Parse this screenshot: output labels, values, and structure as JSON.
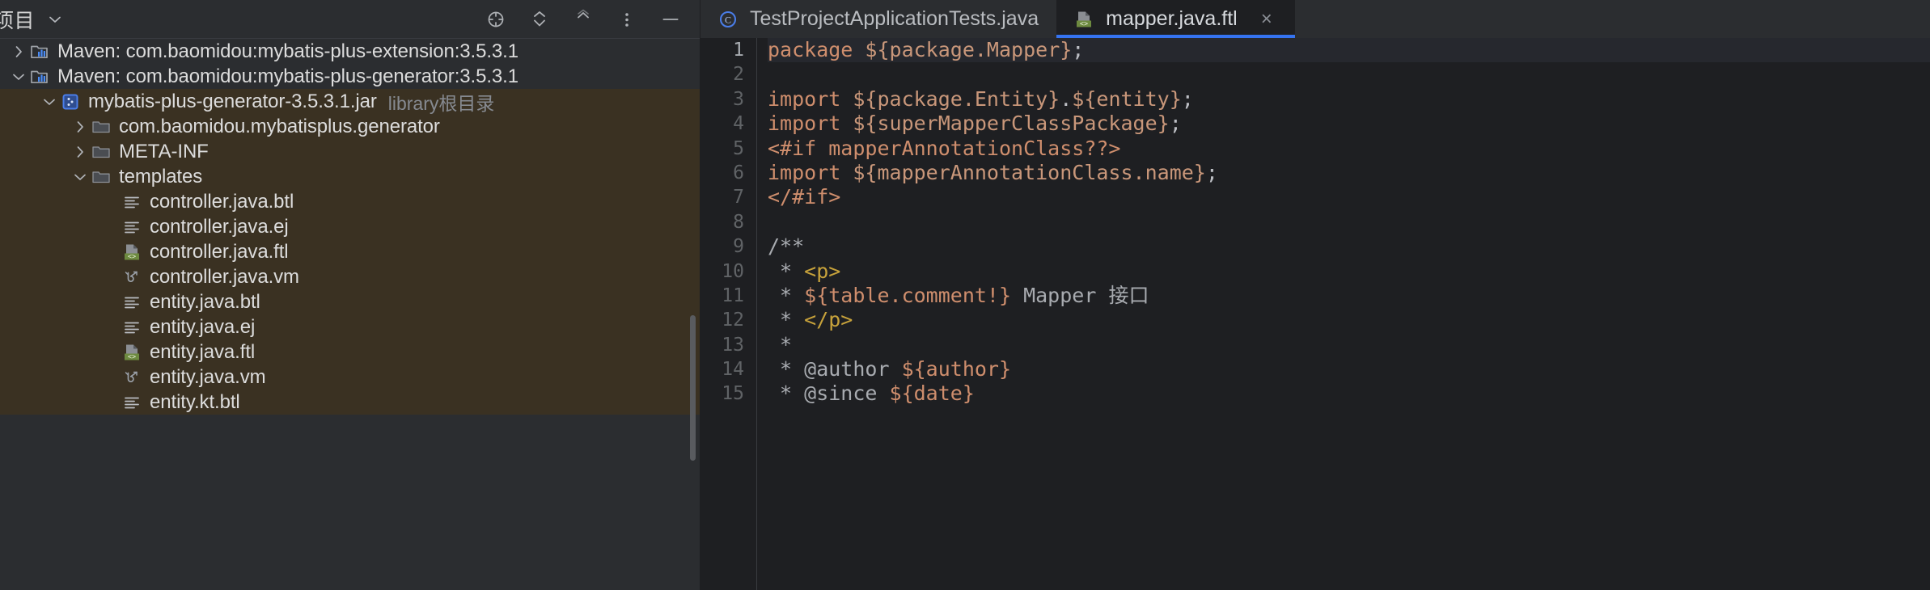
{
  "sidebar": {
    "title": "项目",
    "title_chevron_icon": "chevron-down-icon",
    "tools": [
      {
        "name": "locate-icon",
        "glyph": "target"
      },
      {
        "name": "expand-all-icon",
        "glyph": "double-chevron-down"
      },
      {
        "name": "collapse-all-icon",
        "glyph": "double-chevron-up"
      },
      {
        "name": "more-options-icon",
        "glyph": "vertical-dots"
      },
      {
        "name": "hide-panel-icon",
        "glyph": "minus"
      }
    ],
    "tree": [
      {
        "label": "Maven: com.baomidou:mybatis-plus-extension:3.5.3.1",
        "sub": "",
        "indent": 0,
        "twist": "right",
        "icon": "maven-library-icon",
        "selected": false
      },
      {
        "label": "Maven: com.baomidou:mybatis-plus-generator:3.5.3.1",
        "sub": "",
        "indent": 0,
        "twist": "down",
        "icon": "maven-library-icon",
        "selected": false
      },
      {
        "label": "mybatis-plus-generator-3.5.3.1.jar",
        "sub": "library根目录",
        "indent": 1,
        "twist": "down",
        "icon": "jar-icon",
        "selected": true
      },
      {
        "label": "com.baomidou.mybatisplus.generator",
        "sub": "",
        "indent": 2,
        "twist": "right",
        "icon": "folder-icon",
        "selected": true
      },
      {
        "label": "META-INF",
        "sub": "",
        "indent": 2,
        "twist": "right",
        "icon": "folder-icon",
        "selected": true
      },
      {
        "label": "templates",
        "sub": "",
        "indent": 2,
        "twist": "down",
        "icon": "folder-icon",
        "selected": true
      },
      {
        "label": "controller.java.btl",
        "sub": "",
        "indent": 3,
        "twist": "none",
        "icon": "text-file-icon",
        "selected": true
      },
      {
        "label": "controller.java.ej",
        "sub": "",
        "indent": 3,
        "twist": "none",
        "icon": "text-file-icon",
        "selected": true
      },
      {
        "label": "controller.java.ftl",
        "sub": "",
        "indent": 3,
        "twist": "none",
        "icon": "ftl-file-icon",
        "selected": true
      },
      {
        "label": "controller.java.vm",
        "sub": "",
        "indent": 3,
        "twist": "none",
        "icon": "velocity-file-icon",
        "selected": true
      },
      {
        "label": "entity.java.btl",
        "sub": "",
        "indent": 3,
        "twist": "none",
        "icon": "text-file-icon",
        "selected": true
      },
      {
        "label": "entity.java.ej",
        "sub": "",
        "indent": 3,
        "twist": "none",
        "icon": "text-file-icon",
        "selected": true
      },
      {
        "label": "entity.java.ftl",
        "sub": "",
        "indent": 3,
        "twist": "none",
        "icon": "ftl-file-icon",
        "selected": true
      },
      {
        "label": "entity.java.vm",
        "sub": "",
        "indent": 3,
        "twist": "none",
        "icon": "velocity-file-icon",
        "selected": true
      },
      {
        "label": "entity.kt.btl",
        "sub": "",
        "indent": 3,
        "twist": "none",
        "icon": "text-file-icon",
        "selected": true
      }
    ]
  },
  "editor": {
    "tabs": [
      {
        "label": "TestProjectApplicationTests.java",
        "icon": "java-class-icon",
        "active": false,
        "closable": false
      },
      {
        "label": "mapper.java.ftl",
        "icon": "ftl-file-icon",
        "active": true,
        "closable": true,
        "close_glyph": "×"
      }
    ],
    "caret_line": 1,
    "lines": [
      {
        "n": "1",
        "tokens": [
          {
            "t": "package ",
            "c": "kw"
          },
          {
            "t": "${package.Mapper}",
            "c": "var"
          },
          {
            "t": ";",
            "c": "plain"
          }
        ]
      },
      {
        "n": "2",
        "tokens": []
      },
      {
        "n": "3",
        "tokens": [
          {
            "t": "import ",
            "c": "kw"
          },
          {
            "t": "${package.Entity}",
            "c": "var"
          },
          {
            "t": ".",
            "c": "plain"
          },
          {
            "t": "${entity}",
            "c": "var"
          },
          {
            "t": ";",
            "c": "plain"
          }
        ]
      },
      {
        "n": "4",
        "tokens": [
          {
            "t": "import ",
            "c": "kw"
          },
          {
            "t": "${superMapperClassPackage}",
            "c": "var"
          },
          {
            "t": ";",
            "c": "plain"
          }
        ]
      },
      {
        "n": "5",
        "tokens": [
          {
            "t": "<#if mapperAnnotationClass??>",
            "c": "kw"
          }
        ]
      },
      {
        "n": "6",
        "tokens": [
          {
            "t": "import ",
            "c": "kw"
          },
          {
            "t": "${mapperAnnotationClass.name}",
            "c": "var"
          },
          {
            "t": ";",
            "c": "plain"
          }
        ]
      },
      {
        "n": "7",
        "tokens": [
          {
            "t": "</#if>",
            "c": "kw"
          }
        ]
      },
      {
        "n": "8",
        "tokens": []
      },
      {
        "n": "9",
        "tokens": [
          {
            "t": "/**",
            "c": "com"
          }
        ]
      },
      {
        "n": "10",
        "tokens": [
          {
            "t": " * ",
            "c": "com"
          },
          {
            "t": "<p>",
            "c": "tag"
          }
        ]
      },
      {
        "n": "11",
        "tokens": [
          {
            "t": " * ",
            "c": "com"
          },
          {
            "t": "${table.comment!}",
            "c": "cvar"
          },
          {
            "t": " Mapper 接口",
            "c": "ctext"
          }
        ]
      },
      {
        "n": "12",
        "tokens": [
          {
            "t": " * ",
            "c": "com"
          },
          {
            "t": "</p>",
            "c": "tag"
          }
        ]
      },
      {
        "n": "13",
        "tokens": [
          {
            "t": " *",
            "c": "com"
          }
        ]
      },
      {
        "n": "14",
        "tokens": [
          {
            "t": " * @author ",
            "c": "com"
          },
          {
            "t": "${author}",
            "c": "cvar"
          }
        ]
      },
      {
        "n": "15",
        "tokens": [
          {
            "t": " * @since ",
            "c": "com"
          },
          {
            "t": "${date}",
            "c": "cvar"
          }
        ]
      }
    ]
  },
  "colors": {
    "background": "#1e1f22",
    "panel": "#2b2d30",
    "selection": "#3a3122",
    "accent": "#3573f0",
    "keyword": "#cf8e6d",
    "comment": "#a8abb0",
    "tag": "#c7a23b",
    "ftl_badge": "#6d8a3f"
  }
}
